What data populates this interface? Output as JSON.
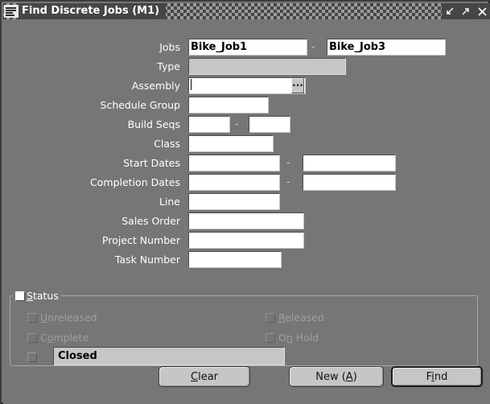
{
  "window": {
    "title": "Find Discrete Jobs (M1)",
    "app_icon": "oracle-logo-icon",
    "controls": [
      {
        "name": "minimize",
        "glyph": "minimize-icon"
      },
      {
        "name": "maximize",
        "glyph": "maximize-icon"
      },
      {
        "name": "close",
        "glyph": "close-icon"
      }
    ]
  },
  "form": {
    "fields": [
      {
        "label": "Jobs",
        "type": "text-range",
        "from_value": "Bike_Job1",
        "to_value": "Bike_Job3",
        "separator": "-"
      },
      {
        "label": "Type",
        "type": "combo",
        "value": "",
        "disabled": true
      },
      {
        "label": "Assembly",
        "type": "text-lov",
        "value": "",
        "lov_label": "...",
        "focused": true
      },
      {
        "label": "Schedule Group",
        "type": "text",
        "value": ""
      },
      {
        "label": "Build Seqs",
        "type": "text-range",
        "from_value": "",
        "to_value": "",
        "separator": "-"
      },
      {
        "label": "Class",
        "type": "text",
        "value": ""
      },
      {
        "label": "Start Dates",
        "type": "text-range",
        "from_value": "",
        "to_value": "",
        "separator": "-"
      },
      {
        "label": "Completion Dates",
        "type": "text-range",
        "from_value": "",
        "to_value": "",
        "separator": "-"
      },
      {
        "label": "Line",
        "type": "text",
        "value": ""
      },
      {
        "label": "Sales Order",
        "type": "text",
        "value": ""
      },
      {
        "label": "Project Number",
        "type": "text",
        "value": ""
      },
      {
        "label": "Task Number",
        "type": "text",
        "value": ""
      }
    ]
  },
  "status_group": {
    "legend_label": "Status",
    "legend_mnemonic": "S",
    "legend_checked": true,
    "checkboxes": [
      {
        "label": "Unreleased",
        "mnemonic": "U",
        "checked": false,
        "enabled": false,
        "column": "left"
      },
      {
        "label": "Released",
        "mnemonic": "R",
        "checked": false,
        "enabled": false,
        "column": "right"
      },
      {
        "label": "Complete",
        "mnemonic": "o",
        "checked": false,
        "enabled": false,
        "column": "left"
      },
      {
        "label": "On Hold",
        "mnemonic": "n",
        "checked": false,
        "enabled": false,
        "column": "right"
      }
    ],
    "status_select": {
      "checked": false,
      "value": "Closed"
    }
  },
  "buttons": {
    "clear": {
      "label_pre": "",
      "mnemonic": "C",
      "label_post": "lear"
    },
    "new": {
      "label_pre": "New (",
      "mnemonic": "A",
      "label_post": ")"
    },
    "find": {
      "label_pre": "F",
      "mnemonic": "i",
      "label_post": "nd",
      "default": true
    }
  },
  "colors": {
    "window_bg": "#767676",
    "titlebar_bg": "#464646",
    "field_bg": "#ffffff",
    "combo_bg": "#c6c6c6",
    "button_bg": "#c6c6c6",
    "label_text": "#ffffff",
    "disabled_text": "#9e9e9e"
  }
}
